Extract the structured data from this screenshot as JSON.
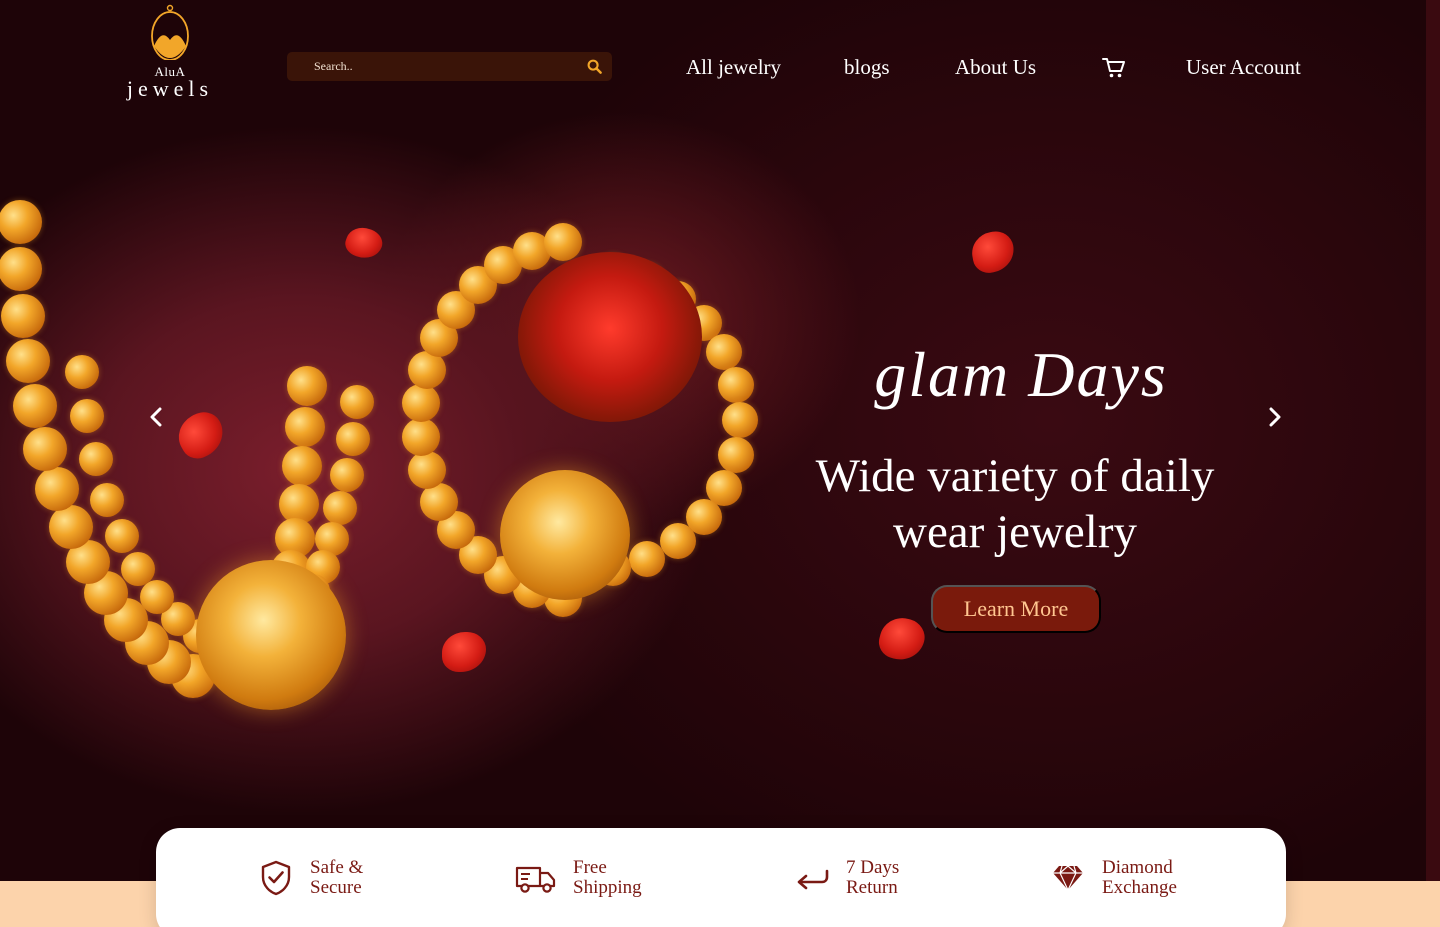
{
  "brand": {
    "name_small": "AluA",
    "name_big": "jewels"
  },
  "search": {
    "placeholder": "Search.."
  },
  "nav": {
    "all_jewelry": "All jewelry",
    "blogs": "blogs",
    "about": "About Us",
    "user_account": "User Account"
  },
  "hero": {
    "script_title": "glam Days",
    "heading_line1": "Wide variety of daily",
    "heading_line2": "wear jewelry",
    "cta": "Learn More"
  },
  "features": [
    {
      "line1": "Safe &",
      "line2": "Secure",
      "icon": "shield-check-icon"
    },
    {
      "line1": "Free",
      "line2": "Shipping",
      "icon": "truck-icon"
    },
    {
      "line1": "7 Days",
      "line2": "Return",
      "icon": "return-arrow-icon"
    },
    {
      "line1": "Diamond",
      "line2": "Exchange",
      "icon": "diamond-icon"
    }
  ],
  "colors": {
    "hero_bg": "#24060b",
    "search_bg": "#3a1408",
    "cta_bg": "#7a1a0c",
    "cta_text": "#ffc690",
    "feature_text": "#7a1a14",
    "footer_band": "#fcd3ab"
  }
}
